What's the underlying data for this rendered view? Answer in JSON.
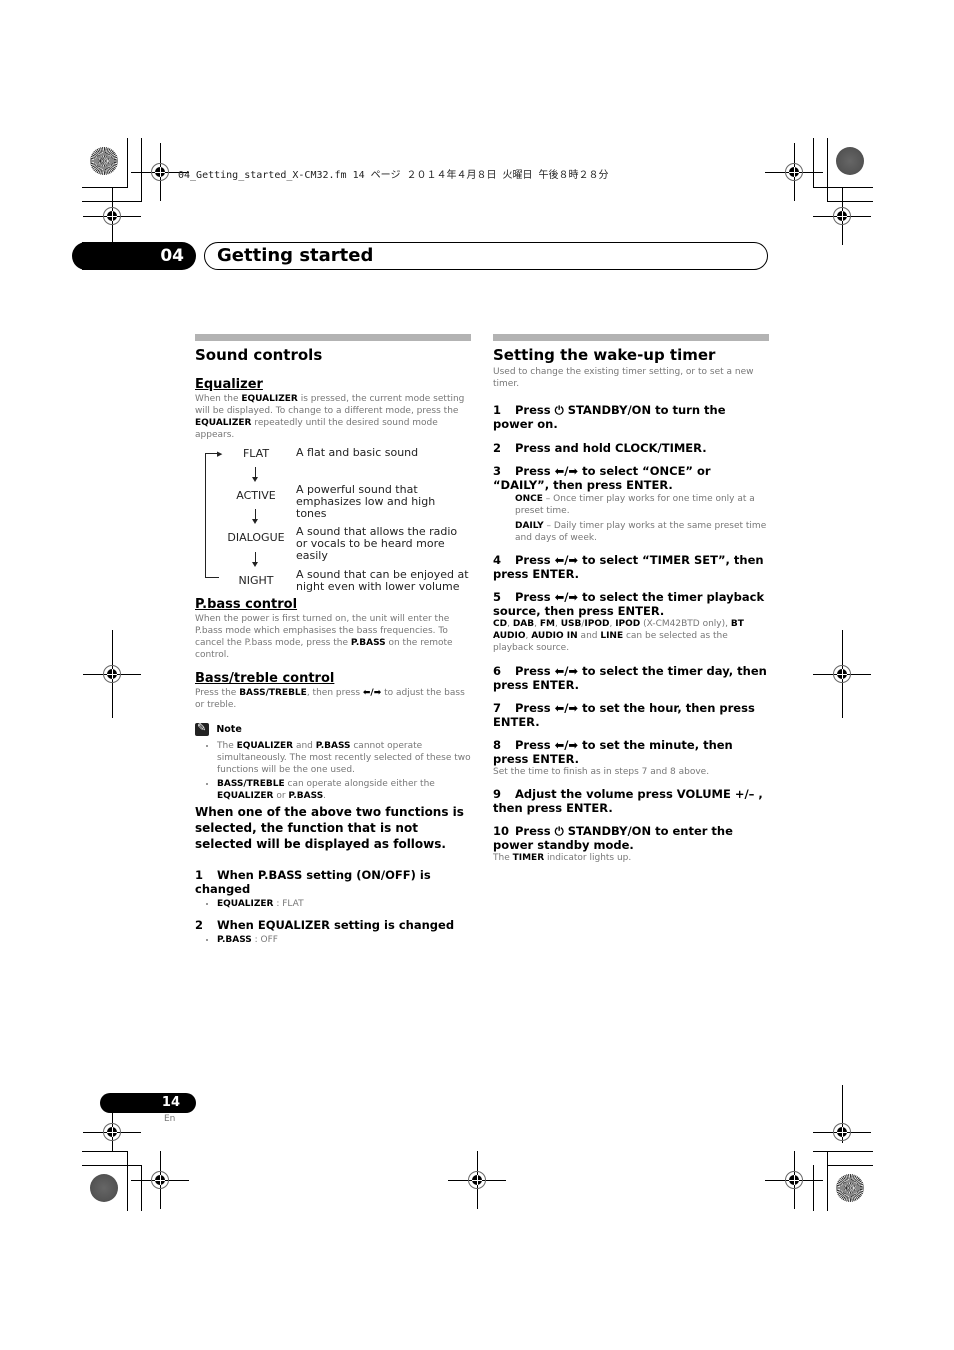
{
  "file_header": "04_Getting_started_X-CM32.fm  14 ページ  ２０１４年４月８日  火曜日  午後８時２８分",
  "chapter": {
    "number": "04",
    "title": "Getting started"
  },
  "left_column": {
    "section_title": "Sound controls",
    "equalizer": {
      "heading": "Equalizer",
      "intro_parts": [
        "When the ",
        "EQUALIZER",
        " is pressed, the current mode setting will be displayed. To change to a different mode, press the ",
        "EQUALIZER",
        " repeatedly until the desired sound mode appears."
      ],
      "modes": [
        {
          "name": "FLAT",
          "description": "A flat and basic sound"
        },
        {
          "name": "ACTIVE",
          "description": "A powerful sound that emphasizes low and high tones"
        },
        {
          "name": "DIALOGUE",
          "description": "A sound that allows the radio or vocals to be heard more easily"
        },
        {
          "name": "NIGHT",
          "description": "A sound that can be enjoyed at night even with lower volume"
        }
      ]
    },
    "pbass": {
      "heading": "P.bass control",
      "text_parts": [
        "When the power is first turned on, the unit will enter the P.bass mode which emphasises the bass frequencies. To cancel the P.bass mode, press the ",
        "P.BASS",
        " on the remote control."
      ]
    },
    "bass_treble": {
      "heading": "Bass/treble control",
      "text_parts": [
        "Press the ",
        "BASS/TREBLE",
        ", then press ",
        "⬅/➡",
        " to adjust the bass or treble."
      ]
    },
    "note": {
      "label": "Note",
      "items": [
        [
          "The ",
          "EQUALIZER",
          " and ",
          "P.BASS",
          " cannot operate simultaneously. The most recently selected of these two functions will be the one used."
        ],
        [
          "",
          "BASS/TREBLE",
          " can operate alongside either the ",
          "EQUALIZER",
          " or ",
          "P.BASS",
          "."
        ]
      ]
    },
    "display_rule": "When one of the above two functions is selected, the function that is not selected will be displayed as follows.",
    "steps": [
      {
        "num": "1",
        "text": "When P.BASS setting (ON/OFF) is changed",
        "bullet_key": "EQUALIZER",
        "bullet_val": " : FLAT"
      },
      {
        "num": "2",
        "text": "When EQUALIZER setting is changed",
        "bullet_key": "P.BASS",
        "bullet_val": " : OFF"
      }
    ]
  },
  "right_column": {
    "section_title": "Setting the wake-up timer",
    "intro": "Used to change the existing timer setting, or to set a new timer.",
    "steps": [
      {
        "num": "1",
        "text": "Press ⏻ STANDBY/ON to turn the power on."
      },
      {
        "num": "2",
        "text": "Press and hold CLOCK/TIMER."
      },
      {
        "num": "3",
        "text": "Press ⬅/➡ to select “ONCE” or “DAILY”, then press ENTER."
      },
      {
        "num": "4",
        "text": "Press ⬅/➡ to select “TIMER SET”, then press ENTER."
      },
      {
        "num": "5",
        "text": "Press ⬅/➡ to select the timer playback source, then press ENTER."
      },
      {
        "num": "6",
        "text": "Press ⬅/➡ to select the timer day, then press ENTER."
      },
      {
        "num": "7",
        "text": "Press ⬅/➡ to set the hour, then press ENTER."
      },
      {
        "num": "8",
        "text": "Press ⬅/➡ to set the minute, then press ENTER."
      },
      {
        "num": "9",
        "text": "Adjust the volume press VOLUME +/– , then press ENTER."
      },
      {
        "num": "10",
        "text": "Press ⏻ STANDBY/ON to enter the power standby mode."
      }
    ],
    "once_key": "ONCE",
    "once_text": " – Once timer play works for one time only at a preset time.",
    "daily_key": "DAILY",
    "daily_text": " – Daily timer play works at the same preset time and days of week.",
    "sources_parts": [
      "CD",
      ", ",
      "DAB",
      ", ",
      "FM",
      ", ",
      "USB",
      "/",
      "IPOD",
      ", ",
      "IPOD",
      " (X-CM42BTD only), ",
      "BT AUDIO",
      ", ",
      "AUDIO IN",
      " and ",
      "LINE",
      " can be selected as the playback source."
    ],
    "step8_note": "Set the time to finish as in steps 7 and 8 above.",
    "step10_parts": [
      "The ",
      "TIMER",
      " indicator lights up."
    ]
  },
  "footer": {
    "page_number": "14",
    "language": "En"
  }
}
